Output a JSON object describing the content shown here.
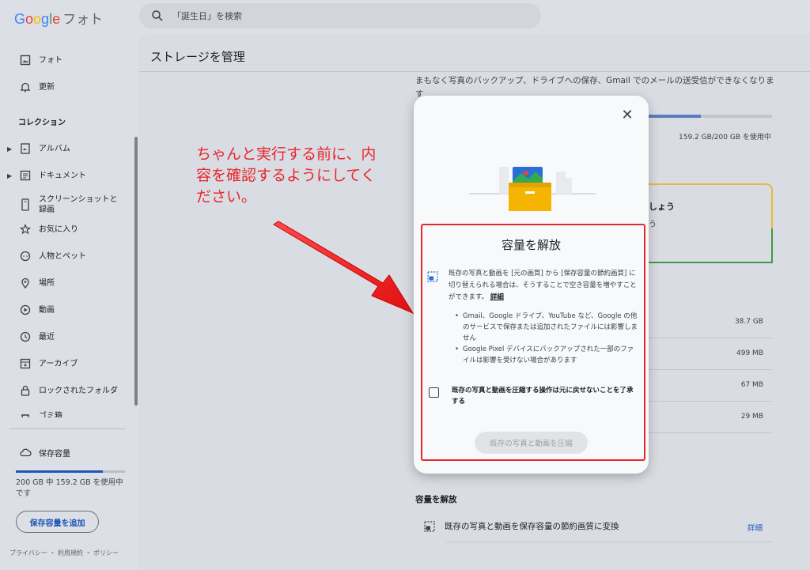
{
  "app": {
    "logo_brand": "Google",
    "logo_product": "フォト",
    "search_placeholder": "「誕生日」を検索"
  },
  "sidebar": {
    "items_top": [
      {
        "label": "フォト",
        "icon": "photo-icon"
      },
      {
        "label": "更新",
        "icon": "bell-icon"
      }
    ],
    "collections_title": "コレクション",
    "items": [
      {
        "label": "アルバム",
        "icon": "album-icon",
        "expandable": true
      },
      {
        "label": "ドキュメント",
        "icon": "document-icon",
        "expandable": true
      },
      {
        "label": "スクリーンショットと録画",
        "icon": "phone-screenshot-icon"
      },
      {
        "label": "お気に入り",
        "icon": "star-icon"
      },
      {
        "label": "人物とペット",
        "icon": "face-icon"
      },
      {
        "label": "場所",
        "icon": "place-icon"
      },
      {
        "label": "動画",
        "icon": "play-icon"
      },
      {
        "label": "最近",
        "icon": "clock-icon"
      },
      {
        "label": "アーカイブ",
        "icon": "archive-icon"
      },
      {
        "label": "ロックされたフォルダ",
        "icon": "lock-icon"
      },
      {
        "label": "ゴミ箱",
        "icon": "trash-icon"
      }
    ],
    "storage": {
      "label": "保存容量",
      "usage_text": "200 GB 中 159.2 GB を使用中です",
      "usage_fraction": 0.796,
      "add_button": "保存容量を追加"
    },
    "footer": "プライバシー ・ 利用規約 ・ ポリシー"
  },
  "main": {
    "title": "ストレージを管理",
    "warning": "まもなく写真のバックアップ、ドライブへの保存、Gmail でのメールの送受信ができなくなります",
    "usage_text": "159.2 GB/200 GB を使用中",
    "tip_title": "しょう",
    "tip_sub": "う",
    "sizes": [
      "38.7 GB",
      "499 MB",
      "67 MB",
      "29 MB"
    ],
    "free_space_title": "容量を解放",
    "free_row_label": "既存の写真と動画を保存容量の節約画質に変換",
    "free_row_more": "詳細"
  },
  "modal": {
    "close": "✕",
    "title": "容量を解放",
    "paragraph": "既存の写真と動画を [元の画質] から [保存容量の節約画質] に切り替えられる場合は、そうすることで空き容量を増やすことができます。",
    "paragraph_link": "詳細",
    "bullets": [
      "Gmail、Google ドライブ、YouTube など、Google の他のサービスで保存または追加されたファイルには影響しません",
      "Google Pixel デバイスにバックアップされた一部のファイルは影響を受けない場合があります"
    ],
    "checkbox_label": "既存の写真と動画を圧縮する操作は元に戻せないことを了承する",
    "checkbox_checked": false,
    "compress_button": "既存の写真と動画を圧縮"
  },
  "annotation": {
    "text": "ちゃんと実行する前に、内容を確認するようにしてください。",
    "color": "#e8262d"
  },
  "colors": {
    "accent": "#1a56b8",
    "highlight": "#e8262d"
  }
}
